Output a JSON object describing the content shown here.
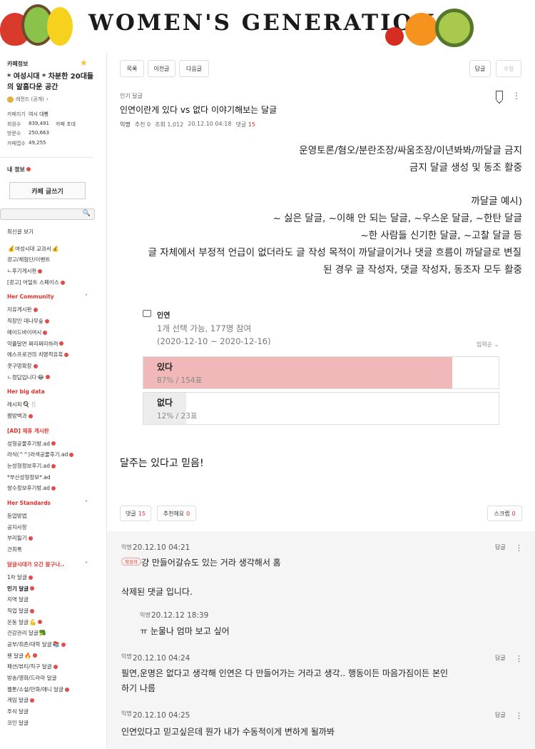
{
  "banner": {
    "title": "WOMEN'S GENERATION"
  },
  "sidebar": {
    "header": "카페정보",
    "cafe_name": "* 여성시대 * 차분한 20대들의 알흠다운 공간",
    "rank": "레전드 (공개)",
    "rank_arrow": "›",
    "stats": [
      {
        "key": "카페지기",
        "value": "여시 대빵",
        "extra": ""
      },
      {
        "key": "회원수",
        "value": "839,491",
        "extra": "카페 초대"
      },
      {
        "key": "방문수",
        "value": "250,663",
        "extra": ""
      },
      {
        "key": "카페앱수",
        "value": "49,255",
        "extra": ""
      }
    ],
    "my_info": "내 정보",
    "write_button": "카페 글쓰기",
    "search_placeholder": "",
    "menu": {
      "recent": "최신글 보기",
      "top": [
        {
          "label": "여성시대 교과서",
          "emoji": "💰",
          "prefix": "💰",
          "dot": false
        },
        {
          "label": "광고/체험단/이벤트",
          "dot": false
        },
        {
          "label": "ㄴ후기게시판",
          "dot": true
        },
        {
          "label": "[광고] 어덜트 스페이스",
          "dot": true
        }
      ],
      "her_community": {
        "title": "Her Community",
        "items": [
          {
            "label": "자유게시판",
            "dot": true
          },
          {
            "label": "직장인 대나무숲",
            "dot": true
          },
          {
            "label": "메이드바이여시",
            "dot": true
          },
          {
            "label": "악플달면 쩌리쩌리하려",
            "dot": true
          },
          {
            "label": "에스프로견의 치명적유혹",
            "dot": true
          },
          {
            "label": "콧구멍확장",
            "dot": true
          },
          {
            "label": "ㄴ정답입니다",
            "dot": true,
            "emoji": "😂"
          }
        ]
      },
      "her_big_data": {
        "title": "Her big data",
        "items": [
          {
            "label": "레시피",
            "emoji": "🍳",
            "dot": false,
            "extra": "🍴"
          },
          {
            "label": "짬방백과",
            "dot": true
          }
        ]
      },
      "ad": {
        "title": "[AD] 제휴 게시판",
        "items": [
          {
            "label": "성형공물후기방.ad",
            "dot": true
          },
          {
            "label": "라식(^^)라섹공물후기.ad",
            "dot": true
          },
          {
            "label": "눈성형정보후기.ad",
            "dot": true
          },
          {
            "label": "*부산성형정보*.ad",
            "dot": false
          },
          {
            "label": "쌍수정보후기방.ad",
            "dot": true
          }
        ]
      },
      "her_standards": {
        "title": "Her Standards",
        "items": [
          {
            "label": "등업방법",
            "dot": false
          },
          {
            "label": "공지사항",
            "dot": false
          },
          {
            "label": "부리될기",
            "dot": true
          },
          {
            "label": "건회록",
            "dot": false
          }
        ]
      },
      "dalgeul": {
        "title": "달글시대가 오긴 왔구나..",
        "items": [
          {
            "label": "1차 달글",
            "dot": true,
            "bold": false
          },
          {
            "label": "인기 달글",
            "dot": true,
            "bold": true
          },
          {
            "label": "지역 달글",
            "dot": false
          },
          {
            "label": "직업 달글",
            "dot": true
          },
          {
            "label": "운동 달글",
            "emoji": "💪",
            "dot": true
          },
          {
            "label": "건강관리 달글",
            "emoji": "🥦",
            "dot": false
          },
          {
            "label": "공부/취준/대학 달글",
            "emoji": "📚",
            "dot": true
          },
          {
            "label": "팬 달글",
            "emoji": "🔥",
            "dot": true
          },
          {
            "label": "패션/뷰티/직구 달글",
            "dot": true
          },
          {
            "label": "방송/영화/드라마 달글",
            "dot": false
          },
          {
            "label": "웹툰/소설/만화/애니 달글",
            "dot": true
          },
          {
            "label": "게임 달글",
            "dot": true
          },
          {
            "label": "주식 달글",
            "dot": false
          },
          {
            "label": "코인 달글",
            "dot": false
          }
        ]
      }
    }
  },
  "toolbar": {
    "list": "목록",
    "prev": "이전글",
    "next": "다음글",
    "reply": "답글",
    "edit": "수정"
  },
  "post": {
    "category": "인기 달글",
    "title": "인연이란게 있다 vs 없다 이야기해보는 달글",
    "author": "익명",
    "recommend": "추천 0",
    "views": "조회 1,012",
    "date": "20.12.10 04:18",
    "comments_label": "댓글",
    "comments_count": "15",
    "rules_line1": "운영토론/혐오/분란조장/싸움조장/이년봐봐/까달글 금지",
    "rules_line2": "금지 달글 생성 및 동조 활중",
    "example_title": "까달글 예시)",
    "example_line1": "~ 싫은 달글, ~이해 안 되는 달글, ~우스운 달글, ~한탄 달글",
    "example_line2": "~한 사람들 신기한 달글, ~고찰 달글 등",
    "example_line3": "글 자체에서 부정적 언급이 없더라도 글 작성 목적이 까달글이거나 댓글 흐름이 까달글로 변질",
    "example_line4": "된 경우 글 작성자, 댓글 작성자, 동조자 모두 활중",
    "conclusion": "달주는 있다고 믿음!"
  },
  "poll": {
    "title": "인연",
    "info": "1개 선택 가능, 177명 참여",
    "period": "(2020-12-10 ~ 2020-12-16)",
    "order": "입력순 ⌄",
    "options": [
      {
        "label": "있다",
        "result": "87% / 154표",
        "percent": 87,
        "color": "#f0b8b8"
      },
      {
        "label": "없다",
        "result": "12% / 23표",
        "percent": 12,
        "color": "#ececec"
      }
    ]
  },
  "footer": {
    "comments_label": "댓글",
    "comments_count": "15",
    "recommend_label": "추천해요",
    "recommend_count": "0",
    "scrap_label": "스크랩",
    "scrap_count": "0"
  },
  "comments": [
    {
      "author": "익명",
      "date": "20.12.10 04:21",
      "badge": "작성자",
      "text": "걍 만들어갈슈도 있는 거라 생각해서 홈",
      "reply": "답글"
    },
    {
      "deleted": "삭제된 댓글 입니다."
    },
    {
      "author": "익명",
      "date": "20.12.12 18:39",
      "text": "ㅠ 눈물나 엄마 보고 싶어"
    },
    {
      "author": "익명",
      "date": "20.12.10 04:24",
      "text_line1": "필연,운명은 없다고 생각해 인연은 다 만들어가는 거라고 생각.. 행동이든 마음가짐이든 본인",
      "text_line2": "하기 나름",
      "reply": "답글"
    },
    {
      "author": "익명",
      "date": "20.12.10 04:25",
      "text": "인연있다고 믿고싶은데 뭔가 내가 수동적이게 변하게 될까봐",
      "reply": "답글"
    }
  ],
  "colors": {
    "accent_red": "#e0312a",
    "poll_yes": "#f0b8b8",
    "poll_no": "#ececec"
  }
}
